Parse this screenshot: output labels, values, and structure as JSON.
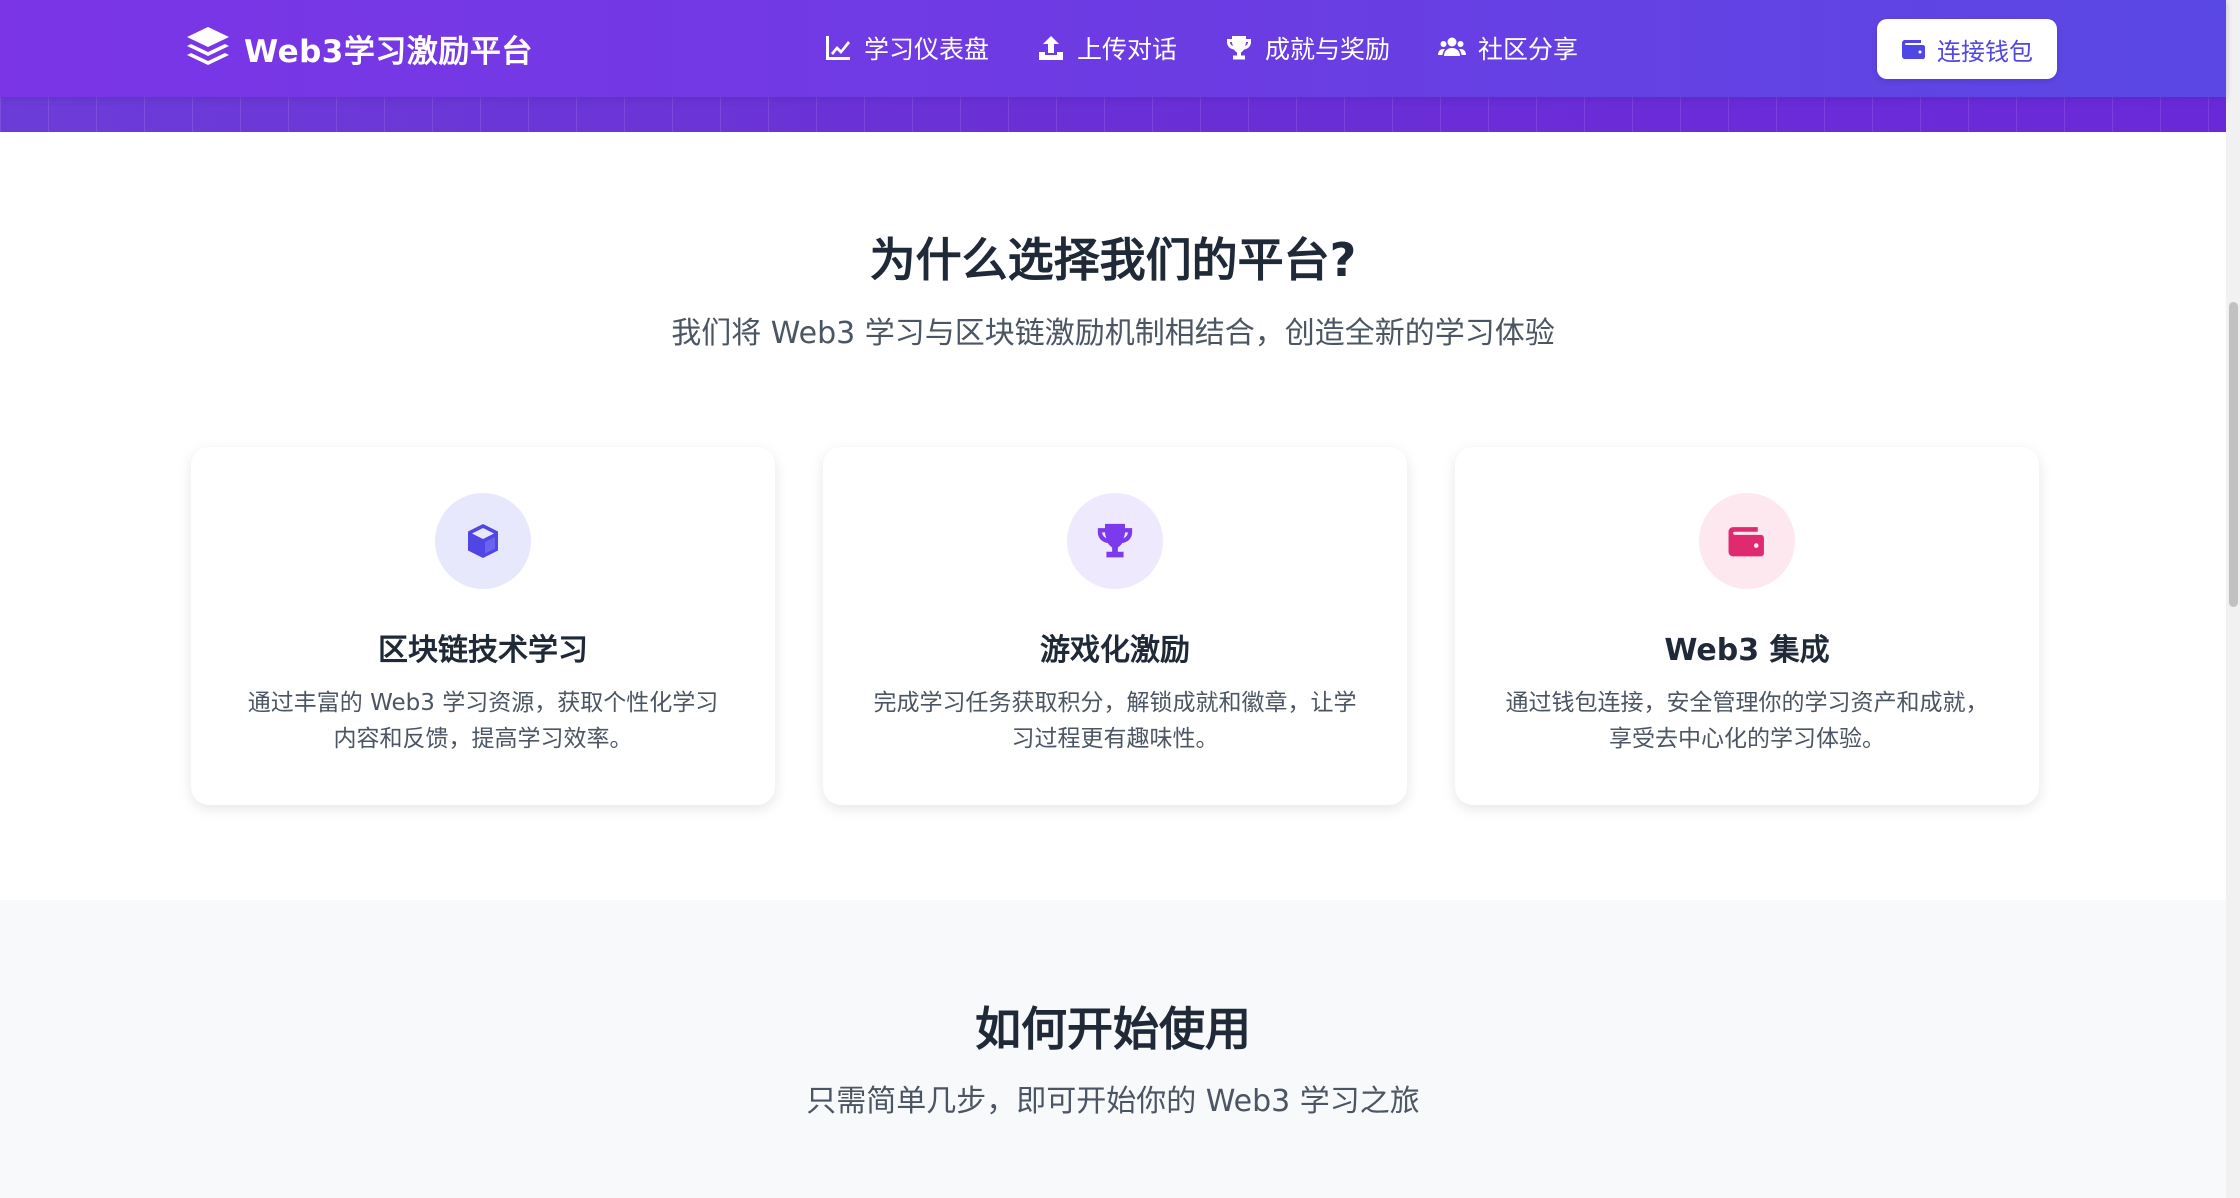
{
  "header": {
    "brand_name": "Web3学习激励平台",
    "nav": [
      {
        "label": "学习仪表盘",
        "icon": "chart-line-icon"
      },
      {
        "label": "上传对话",
        "icon": "upload-icon"
      },
      {
        "label": "成就与奖励",
        "icon": "trophy-icon"
      },
      {
        "label": "社区分享",
        "icon": "users-icon"
      }
    ],
    "connect_label": "连接钱包"
  },
  "why": {
    "title": "为什么选择我们的平台?",
    "subtitle": "我们将 Web3 学习与区块链激励机制相结合，创造全新的学习体验",
    "cards": [
      {
        "icon": "cube-icon",
        "icon_color": "#4f46e5",
        "bg_color": "#e7e8fc",
        "title": "区块链技术学习",
        "desc": "通过丰富的 Web3 学习资源，获取个性化学习内容和反馈，提高学习效率。"
      },
      {
        "icon": "trophy-icon",
        "icon_color": "#7c3aed",
        "bg_color": "#efe9fd",
        "title": "游戏化激励",
        "desc": "完成学习任务获取积分，解锁成就和徽章，让学习过程更有趣味性。"
      },
      {
        "icon": "wallet-icon",
        "icon_color": "#e02a6f",
        "bg_color": "#fde8ef",
        "title": "Web3 集成",
        "desc": "通过钱包连接，安全管理你的学习资产和成就，享受去中心化的学习体验。"
      }
    ]
  },
  "how": {
    "title": "如何开始使用",
    "subtitle": "只需简单几步，即可开始你的 Web3 学习之旅"
  },
  "colors": {
    "header_start": "#7b35e6",
    "header_end": "#5a48e4",
    "accent": "#5046e5"
  }
}
